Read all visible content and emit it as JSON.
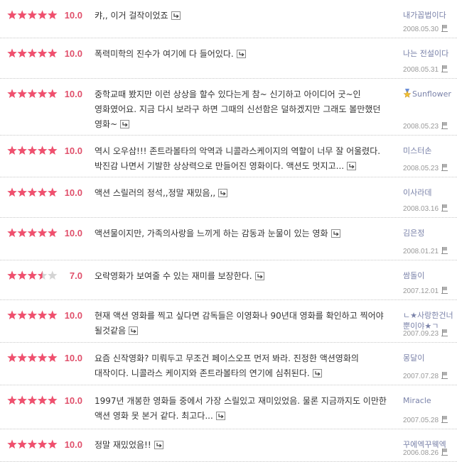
{
  "reviews": [
    {
      "rating": 10.0,
      "score": "10.0",
      "comment": "캬,, 이거 걸작이었죠",
      "author": "내가꼽법이다",
      "date": "2008.05.30"
    },
    {
      "rating": 10.0,
      "score": "10.0",
      "comment": "폭력미학의 진수가 여기에 다 들어있다.",
      "author": "나는 전설이다",
      "date": "2008.05.31"
    },
    {
      "rating": 10.0,
      "score": "10.0",
      "comment": "중학교때 봤지만 이런 상상을 할수 있다는게 참~ 신기하고 아이디어 굿~인 영화였어요. 지금 다시 보라구 하면 그때의 신선함은 덜하겠지만 그래도 볼만했던 영화~",
      "author": "Sunflower",
      "author_badge": "medal-icon",
      "date": "2008.05.23"
    },
    {
      "rating": 10.0,
      "score": "10.0",
      "comment": "역시 오우삼!!! 존트라볼타의 악역과 니콜라스케이지의 역할이 너무 잘 어울렸다. 박진감 나면서 기발한 상상력으로 만들어진 영화이다. 액션도 멋지고...",
      "author": "미스터손",
      "date": "2008.05.23"
    },
    {
      "rating": 10.0,
      "score": "10.0",
      "comment": "액션 스릴러의 정석,,정말 재밌음,,",
      "author": "이사라데",
      "date": "2008.03.16"
    },
    {
      "rating": 10.0,
      "score": "10.0",
      "comment": "액션물이지만, 가족의사랑을 느끼게 하는 감동과 눈물이 있는 영화",
      "author": "김은정",
      "date": "2008.01.21"
    },
    {
      "rating": 7.0,
      "score": "7.0",
      "comment": "오락영화가 보여줄 수 있는 재미를 보장한다.",
      "author": "쌈돌이",
      "date": "2007.12.01"
    },
    {
      "rating": 10.0,
      "score": "10.0",
      "comment": "현재 액션 영화를 찍고 싶다면 감독들은 이영화나 90년대 영화를 확인하고 찍어야 될것같음",
      "author": "ㄴ★사랑한건너뿐이야★ㄱ",
      "date": "2007.09.23"
    },
    {
      "rating": 10.0,
      "score": "10.0",
      "comment": "요즘 신작영화? 미뤄두고 무조건 페이스오프 먼저 봐라. 진정한 액션영화의 대작이다. 니콜라스 케이지와 존트라볼타의 연기에 심취된다.",
      "author": "몽달이",
      "date": "2007.07.28"
    },
    {
      "rating": 10.0,
      "score": "10.0",
      "comment": "1997년 개봉한 영화들 중에서 가장 스릴있고 재미있었음. 물론 지금까지도 이만한 액션 영화 못 본거 같다. 최고다...",
      "author": "Miracle",
      "date": "2007.05.28"
    },
    {
      "rating": 10.0,
      "score": "10.0",
      "comment": "정말 재밌었음!!",
      "author": "꾸에엑꾸웩엑",
      "date": "2006.08.26"
    }
  ],
  "icons": {
    "reply": "reply-arrow-icon",
    "report": "report-flag-icon",
    "star": "star-icon"
  },
  "colors": {
    "star_on": "#f0506e",
    "star_off": "#d4d4d4",
    "score": "#e0506b",
    "author": "#7a82a9",
    "date": "#999999"
  }
}
